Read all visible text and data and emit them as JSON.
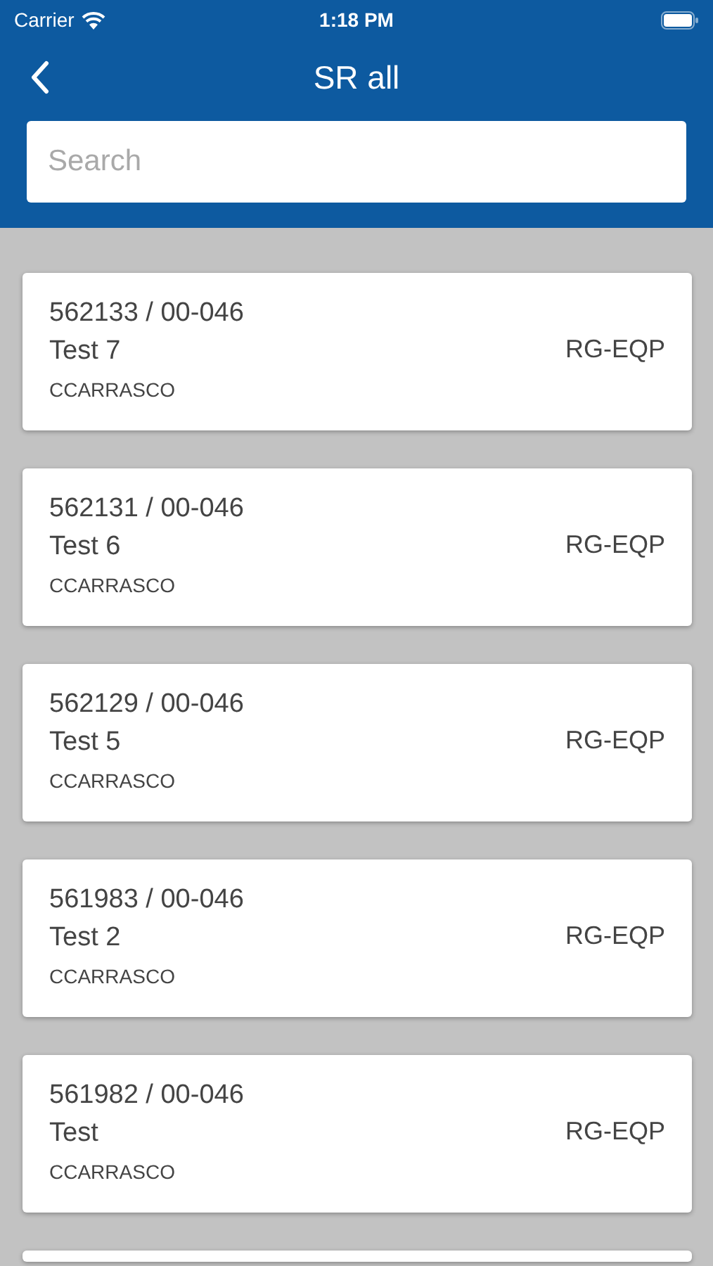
{
  "status_bar": {
    "carrier": "Carrier",
    "time": "1:18 PM"
  },
  "nav": {
    "title": "SR all"
  },
  "search": {
    "placeholder": "Search"
  },
  "items": [
    {
      "number": "562133 / 00-046",
      "title": "Test 7",
      "user": "CCARRASCO",
      "code": "RG-EQP"
    },
    {
      "number": "562131 / 00-046",
      "title": "Test 6",
      "user": "CCARRASCO",
      "code": "RG-EQP"
    },
    {
      "number": "562129 / 00-046",
      "title": "Test 5",
      "user": "CCARRASCO",
      "code": "RG-EQP"
    },
    {
      "number": "561983 / 00-046",
      "title": "Test 2",
      "user": "CCARRASCO",
      "code": "RG-EQP"
    },
    {
      "number": "561982 / 00-046",
      "title": "Test",
      "user": "CCARRASCO",
      "code": "RG-EQP"
    }
  ]
}
